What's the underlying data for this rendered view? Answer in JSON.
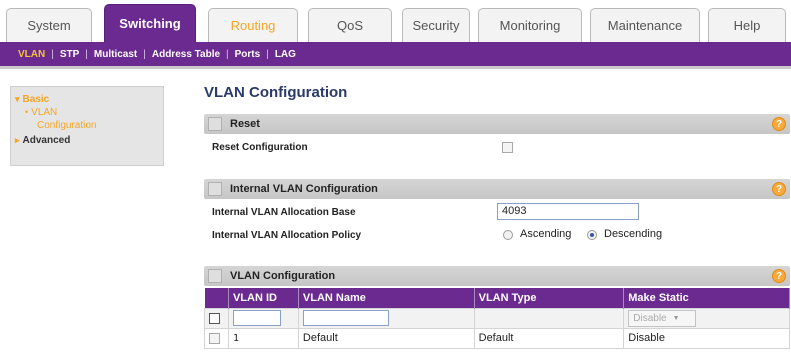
{
  "tabs": [
    {
      "label": "System"
    },
    {
      "label": "Switching"
    },
    {
      "label": "Routing"
    },
    {
      "label": "QoS"
    },
    {
      "label": "Security"
    },
    {
      "label": "Monitoring"
    },
    {
      "label": "Maintenance"
    },
    {
      "label": "Help"
    }
  ],
  "subnav": [
    "VLAN",
    "STP",
    "Multicast",
    "Address Table",
    "Ports",
    "LAG"
  ],
  "sidebar": {
    "basic": "Basic",
    "vlan_line1": "VLAN",
    "vlan_line2": "Configuration",
    "advanced": "Advanced"
  },
  "page_title": "VLAN Configuration",
  "reset": {
    "title": "Reset",
    "row_label": "Reset Configuration"
  },
  "internal": {
    "title": "Internal VLAN Configuration",
    "base_label": "Internal VLAN Allocation Base",
    "base_value": "4093",
    "policy_label": "Internal VLAN Allocation Policy",
    "opt_ascending": "Ascending",
    "opt_descending": "Descending",
    "selected": "Descending"
  },
  "vlan_table": {
    "title": "VLAN Configuration",
    "columns": [
      "VLAN ID",
      "VLAN Name",
      "VLAN Type",
      "Make Static"
    ],
    "select_value": "Disable",
    "rows": [
      {
        "id": "1",
        "name": "Default",
        "type": "Default",
        "make_static": "Disable"
      }
    ]
  },
  "colors": {
    "brand_purple": "#6a2a8f",
    "accent_orange": "#f5a623",
    "title_blue": "#2a3a6a"
  },
  "icons": {
    "help": "help-icon",
    "section_toggle": "section-toggle-icon"
  }
}
